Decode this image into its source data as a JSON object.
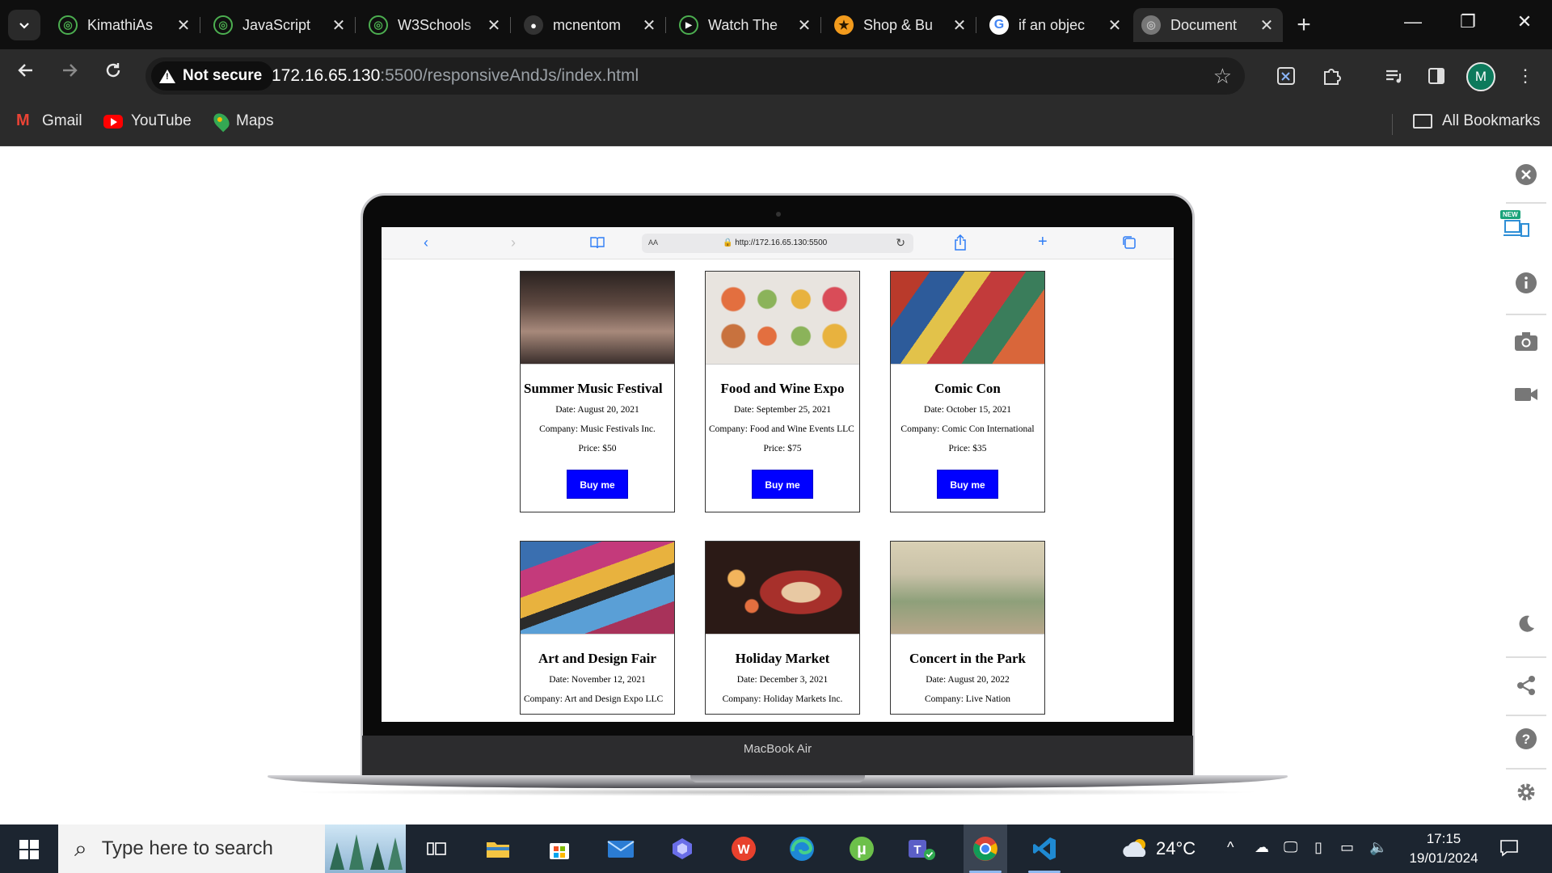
{
  "browser": {
    "tabs": [
      {
        "title": "KimathiAs",
        "icon": "globe-icon",
        "color": "#4caf50",
        "active": false
      },
      {
        "title": "JavaScript",
        "icon": "globe-icon",
        "color": "#4caf50",
        "active": false
      },
      {
        "title": "W3Schools",
        "icon": "globe-icon",
        "color": "#4caf50",
        "active": false
      },
      {
        "title": "mcnentom",
        "icon": "github-icon",
        "color": "#333333",
        "active": false
      },
      {
        "title": "Watch The",
        "icon": "play-icon",
        "color": "#4caf50",
        "active": false
      },
      {
        "title": "Shop & Bu",
        "icon": "star-icon",
        "color": "#f29b1d",
        "active": false
      },
      {
        "title": "if an objec",
        "icon": "google-icon",
        "color": "#4285f4",
        "active": false
      },
      {
        "title": "Document",
        "icon": "globe-icon",
        "color": "#777777",
        "active": true
      }
    ],
    "tab_close": "✕",
    "new_tab": "+",
    "window_controls": {
      "minimize": "—",
      "restore": "❐",
      "close": "✕"
    },
    "security": "Not secure",
    "url_host": "172.16.65.130",
    "url_rest": ":5500/responsiveAndJs/index.html",
    "profile_initial": "M",
    "bookmarks": [
      {
        "label": "Gmail",
        "icon": "gmail-icon"
      },
      {
        "label": "YouTube",
        "icon": "youtube-icon"
      },
      {
        "label": "Maps",
        "icon": "maps-icon"
      }
    ],
    "all_bookmarks": "All Bookmarks"
  },
  "laptop": {
    "label": "MacBook Air",
    "safari_url": "http://172.16.65.130:5500",
    "safari_aa": "AA"
  },
  "events": [
    {
      "title": "Summer Music Festival",
      "date": "Date: August 20, 2021",
      "company": "Company: Music Festivals Inc.",
      "price": "Price: $50",
      "button": "Buy me",
      "image": "crowd-photo",
      "colors": [
        "#3b2f2c",
        "#8a6a5d",
        "#c9b3a6"
      ]
    },
    {
      "title": "Food and Wine Expo",
      "date": "Date: September 25, 2021",
      "company": "Company: Food and Wine Events LLC",
      "price": "Price: $75",
      "button": "Buy me",
      "image": "food-photo",
      "colors": [
        "#e8e4df",
        "#e36f3f",
        "#8bb35a"
      ]
    },
    {
      "title": "Comic Con",
      "date": "Date: October 15, 2021",
      "company": "Company: Comic Con International",
      "price": "Price: $35",
      "button": "Buy me",
      "image": "comics-photo",
      "colors": [
        "#b93a2b",
        "#2d5b9a",
        "#e2c24a"
      ]
    },
    {
      "title": "Art and Design Fair",
      "date": "Date: November 12, 2021",
      "company": "Company: Art and Design Expo LLC",
      "image": "brushes-photo",
      "colors": [
        "#3a6fb0",
        "#c43a7b",
        "#e8b23e"
      ]
    },
    {
      "title": "Holiday Market",
      "date": "Date: December 3, 2021",
      "company": "Company: Holiday Markets Inc.",
      "image": "market-photo",
      "colors": [
        "#2b1a16",
        "#a7302b",
        "#e8c9a3"
      ]
    },
    {
      "title": "Concert in the Park",
      "date": "Date: August 20, 2022",
      "company": "Company: Live Nation",
      "image": "park-concert-photo",
      "colors": [
        "#c9c2a8",
        "#8ea07a",
        "#e6d6b8"
      ]
    }
  ],
  "side_panel": {
    "new_badge": "NEW"
  },
  "taskbar": {
    "search_placeholder": "Type here to search",
    "weather": "24°C",
    "time": "17:15",
    "date": "19/01/2024"
  }
}
